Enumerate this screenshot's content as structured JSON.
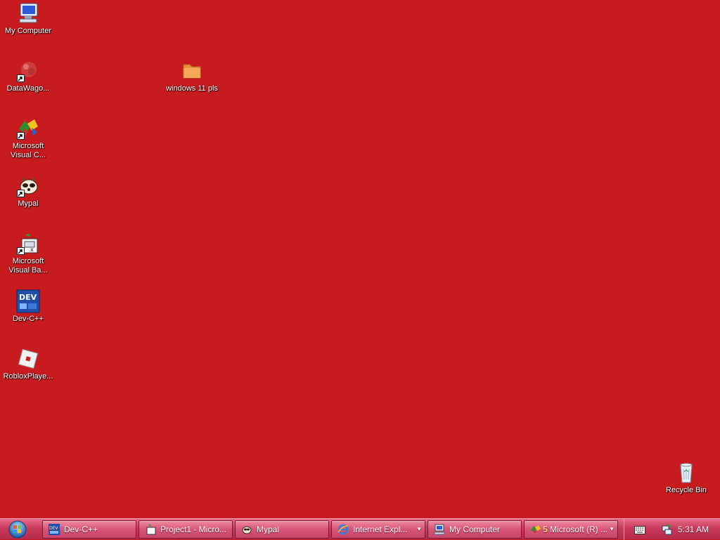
{
  "desktop": {
    "icons": [
      {
        "label": "My Computer"
      },
      {
        "label": "DataWago..."
      },
      {
        "label": "Microsoft Visual C..."
      },
      {
        "label": "Mypal"
      },
      {
        "label": "Microsoft Visual Ba..."
      },
      {
        "label": "Dev-C++"
      },
      {
        "label": "RobloxPlaye..."
      },
      {
        "label": "windows 11 pls"
      },
      {
        "label": "Recycle Bin"
      }
    ]
  },
  "taskbar": {
    "buttons": [
      {
        "label": "Dev-C++"
      },
      {
        "label": "Project1 - Micro..."
      },
      {
        "label": "Mypal"
      },
      {
        "label": "Internet Expl..."
      },
      {
        "label": "My Computer"
      },
      {
        "label": "Microsoft (R) ..."
      }
    ],
    "group_count": "5",
    "clock": "5:31 AM"
  },
  "colors": {
    "desktop_background": "#c81b1f",
    "taskbar": "#c93a5c"
  }
}
